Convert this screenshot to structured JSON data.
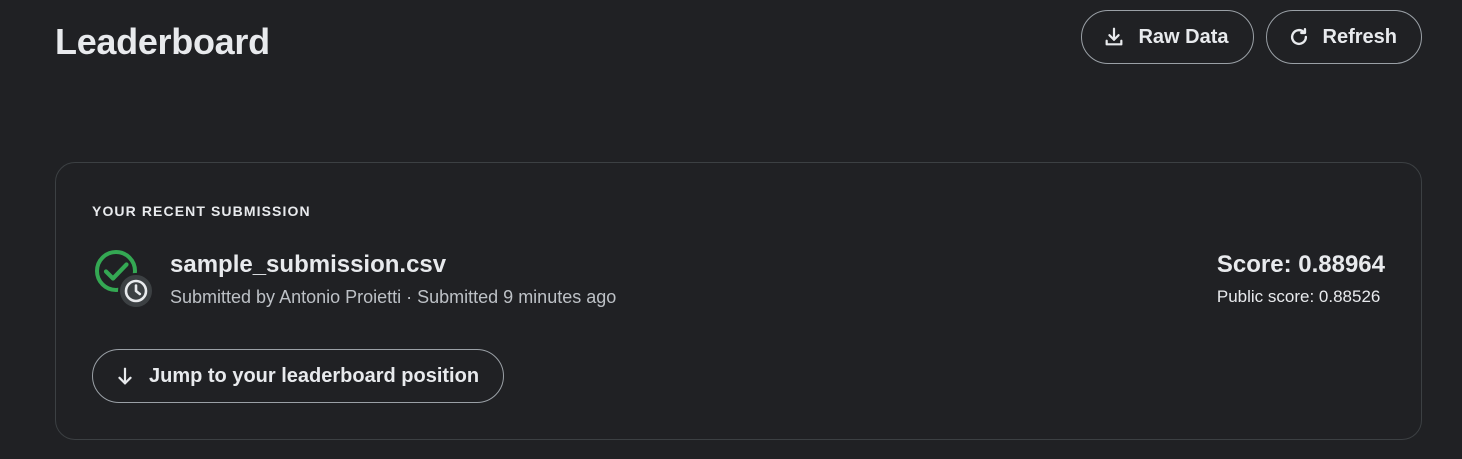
{
  "header": {
    "title": "Leaderboard",
    "raw_data_label": "Raw Data",
    "refresh_label": "Refresh",
    "raw_data_icon": "download-icon",
    "refresh_icon": "refresh-icon"
  },
  "recent_submission": {
    "section_label": "YOUR RECENT SUBMISSION",
    "file_name": "sample_submission.csv",
    "meta": "Submitted by Antonio Proietti · Submitted 9 minutes ago",
    "score": "Score: 0.88964",
    "public_score": "Public score: 0.88526",
    "jump_label": "Jump to your leaderboard position",
    "status_icon": "check-circle-icon",
    "status_badge_icon": "clock-icon",
    "jump_icon": "arrow-down-icon"
  },
  "colors": {
    "background": "#202124",
    "success": "#34a853",
    "text": "#e8eaed",
    "muted_text": "#bdc1c6",
    "border": "#3c4043"
  }
}
